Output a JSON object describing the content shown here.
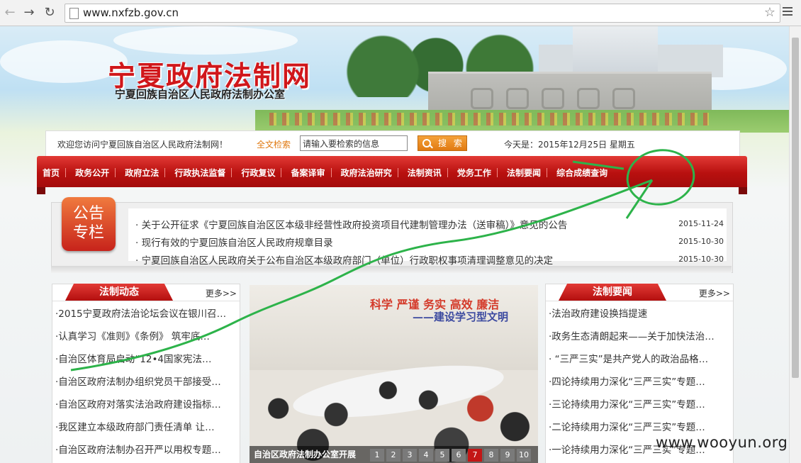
{
  "browser": {
    "url": "www.nxfzb.gov.cn",
    "back_icon": "back-arrow-icon",
    "forward_icon": "forward-arrow-icon",
    "reload_icon": "reload-icon"
  },
  "header": {
    "site_title": "宁夏政府法制网",
    "site_subtitle": "宁夏回族自治区人民政府法制办公室"
  },
  "info_bar": {
    "welcome": "欢迎您访问宁夏回族自治区人民政府法制网！",
    "fulltext_label": "全文检索",
    "search_placeholder": "请输入要检索的信息",
    "search_button": "搜 索",
    "today": "今天是：2015年12月25日 星期五"
  },
  "nav": {
    "items": [
      "首页",
      "政务公开",
      "政府立法",
      "行政执法监督",
      "行政复议",
      "备案译审",
      "政府法治研究",
      "法制资讯",
      "党务工作",
      "法制要闻",
      "综合成绩查询"
    ]
  },
  "notice": {
    "badge_line1": "公告",
    "badge_line2": "专栏",
    "items": [
      {
        "title": "· 关于公开征求《宁夏回族自治区区本级非经营性政府投资项目代建制管理办法（送审稿）》意见的公告",
        "date": "2015-11-24"
      },
      {
        "title": "· 现行有效的宁夏回族自治区人民政府规章目录",
        "date": "2015-10-30"
      },
      {
        "title": "· 宁夏回族自治区人民政府关于公布自治区本级政府部门（单位）行政职权事项清理调整意见的决定",
        "date": "2015-10-30"
      }
    ]
  },
  "left_panel": {
    "title": "法制动态",
    "more": "更多>>",
    "items": [
      "·2015宁夏政府法治论坛会议在银川召…",
      "·认真学习《准则》《条例》 筑牢底…",
      "·自治区体育局启动“12•4国家宪法…",
      "·自治区政府法制办组织党员干部接受…",
      "·自治区政府对落实法治政府建设指标…",
      "·我区建立本级政府部门责任清单 让…",
      "·自治区政府法制办召开严以用权专题…"
    ]
  },
  "photo": {
    "slogan_top": "科学 严谨 务实 高效 廉洁",
    "slogan_bottom": "——建设学习型文明",
    "caption": "自治区政府法制办公室开展",
    "pages": [
      "1",
      "2",
      "3",
      "4",
      "5",
      "6",
      "7",
      "8",
      "9",
      "10"
    ],
    "active_page": "7"
  },
  "right_panel": {
    "title": "法制要闻",
    "more": "更多>>",
    "items": [
      "·法治政府建设换挡提速",
      "·政务生态清朗起来——关于加快法治…",
      "· “三严三实”是共产党人的政治品格…",
      "·四论持续用力深化“三严三实”专题…",
      "·三论持续用力深化“三严三实”专题…",
      "·二论持续用力深化“三严三实”专题…",
      "·一论持续用力深化“三严三实”专题…"
    ]
  },
  "watermark": "www.wooyun.org",
  "colors": {
    "brand_red": "#c31616",
    "accent_orange": "#e07a12",
    "annotation_green": "#2db34a"
  }
}
